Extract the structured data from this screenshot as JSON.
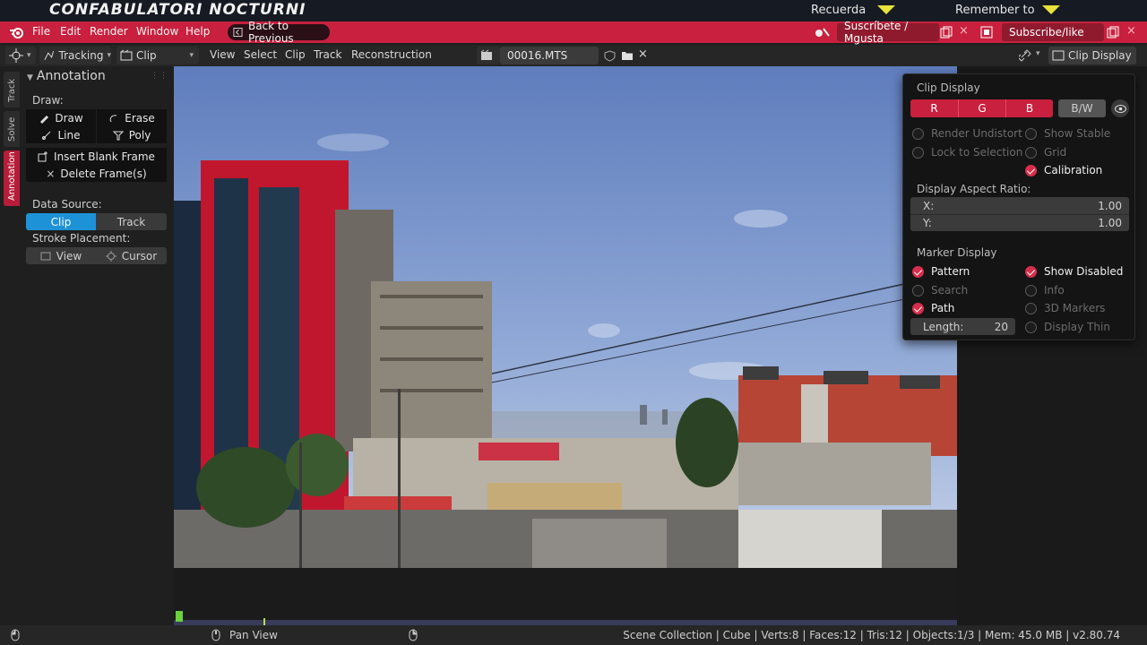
{
  "banner": {
    "title": "CONFABULATORI NOCTURNI",
    "reminder_left": "Recuerda",
    "reminder_right": "Remember to"
  },
  "menubar": {
    "items": [
      "File",
      "Edit",
      "Render",
      "Window",
      "Help"
    ],
    "back_button": "Back to Previous",
    "subscribe_es": "Suscríbete / Mgusta",
    "subscribe_en": "Subscribe/like"
  },
  "clip_header": {
    "mode": "Tracking",
    "view": "Clip",
    "menus": [
      "View",
      "Select",
      "Clip",
      "Track",
      "Reconstruction"
    ],
    "filename": "00016.MTS",
    "clip_display_button": "Clip Display"
  },
  "side_tabs": [
    "Track",
    "Solve",
    "Annotation"
  ],
  "annotation_panel": {
    "header": "Annotation",
    "draw_label": "Draw:",
    "draw": "Draw",
    "erase": "Erase",
    "line": "Line",
    "poly": "Poly",
    "insert_blank": "Insert Blank Frame",
    "delete_frames": "Delete Frame(s)",
    "data_source_label": "Data Source:",
    "source_clip": "Clip",
    "source_track": "Track",
    "stroke_placement_label": "Stroke Placement:",
    "placement_view": "View",
    "placement_cursor": "Cursor"
  },
  "clip_display": {
    "header": "Clip Display",
    "channels": [
      "R",
      "G",
      "B"
    ],
    "bw": "B/W",
    "render_undistort": "Render Undistort",
    "show_stable": "Show Stable",
    "lock_to_selection": "Lock to Selection",
    "grid": "Grid",
    "calibration": "Calibration",
    "aspect_label": "Display Aspect Ratio:",
    "x_label": "X:",
    "x_value": "1.00",
    "y_label": "Y:",
    "y_value": "1.00",
    "marker_label": "Marker Display",
    "pattern": "Pattern",
    "show_disabled": "Show Disabled",
    "search": "Search",
    "info": "Info",
    "path": "Path",
    "markers_3d": "3D Markers",
    "length_label": "Length:",
    "length_value": "20",
    "display_thin": "Display Thin"
  },
  "status_bar": {
    "pan_view": "Pan View",
    "stats": "Scene Collection | Cube | Verts:8 | Faces:12 | Tris:12 | Objects:1/3 | Mem: 45.0 MB | v2.80.74"
  },
  "colors": {
    "accent": "#c8203e",
    "highlight_blue": "#1e92d6",
    "playhead": "#6ad23a"
  }
}
